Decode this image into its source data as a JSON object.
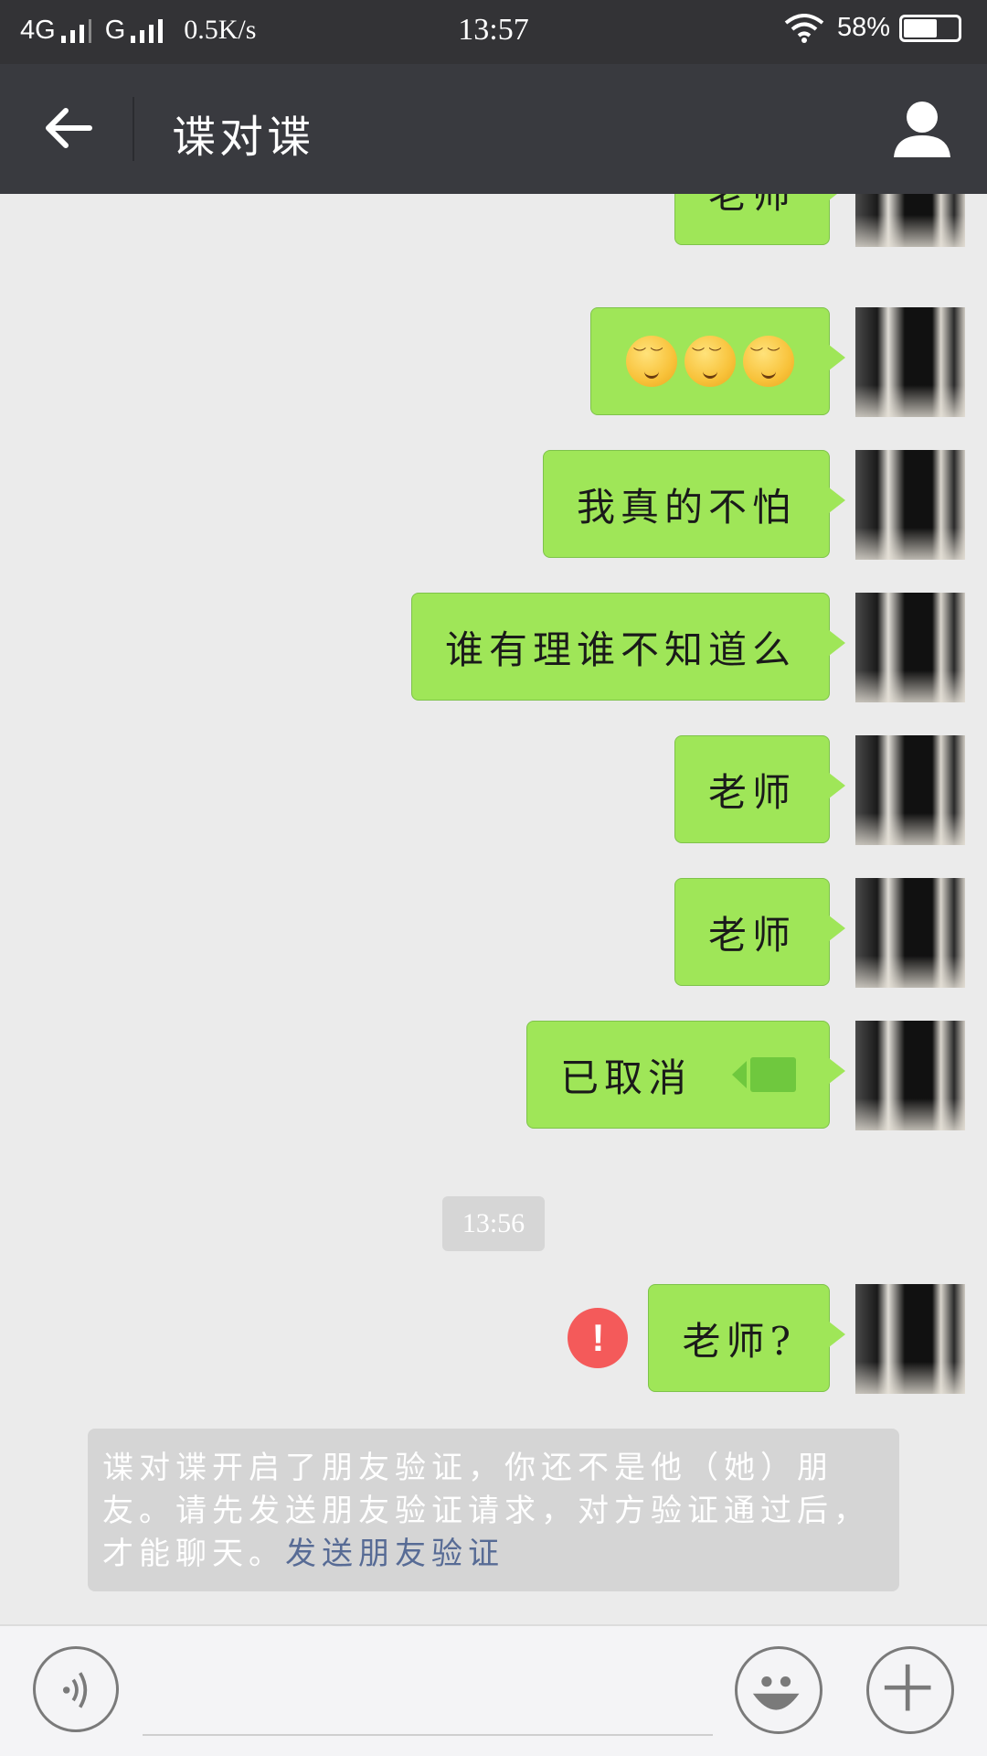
{
  "status_bar": {
    "network1": "4G",
    "network2": "G",
    "speed": "0.5K/s",
    "time": "13:57",
    "battery": "58%"
  },
  "header": {
    "title": "谍对谍"
  },
  "messages": [
    {
      "text": "老师"
    },
    {
      "emoji": [
        "relieved-face",
        "relieved-face",
        "relieved-face"
      ]
    },
    {
      "text": "我真的不怕"
    },
    {
      "text": "谁有理谁不知道么"
    },
    {
      "text": "老师"
    },
    {
      "text": "老师"
    },
    {
      "text": "已取消",
      "icon": "video-call-icon"
    },
    {
      "text": "老师?",
      "status": "failed"
    }
  ],
  "timestamp": "13:56",
  "error_mark": "!",
  "notice": {
    "text": "谍对谍开启了朋友验证，你还不是他（她）朋友。请先发送朋友验证请求，对方验证通过后，才能聊天。",
    "link": "发送朋友验证"
  },
  "colors": {
    "bubble": "#9fe658",
    "header": "#393a3f",
    "error": "#f45a5a",
    "link": "#576b95"
  }
}
